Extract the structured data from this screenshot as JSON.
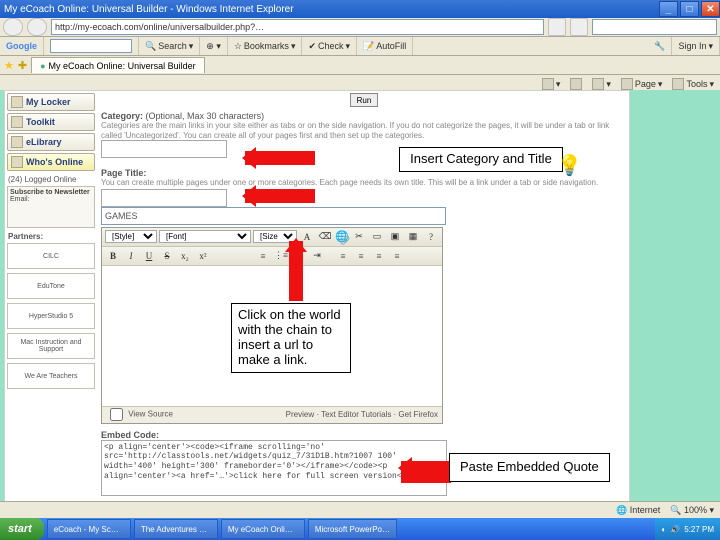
{
  "window": {
    "title": "My eCoach Online: Universal Builder - Windows Internet Explorer"
  },
  "address": "http://my-ecoach.com/online/universalbuilder.php?…",
  "google_bar": {
    "brand": "Google",
    "search_btn": "Search",
    "bookmarks": "Bookmarks",
    "check": "Check",
    "autofill": "AutoFill",
    "signin": "Sign In"
  },
  "tab": {
    "label": "My eCoach Online: Universal Builder"
  },
  "cmdbar": {
    "home": "",
    "print": "",
    "page": "Page",
    "tools": "Tools"
  },
  "sidebar": {
    "buttons": [
      {
        "label": "My Locker"
      },
      {
        "label": "Toolkit"
      },
      {
        "label": "eLibrary"
      },
      {
        "label": "Who's Online"
      },
      {
        "label": "(24) Logged Online"
      }
    ],
    "newsletter_title": "Subscribe to Newsletter",
    "newsletter_sub": "Email:",
    "partners_label": "Partners:",
    "partners": [
      "CILC",
      "EduTone",
      "HyperStudio 5",
      "Mac Instruction and Support",
      "We Are Teachers"
    ]
  },
  "form": {
    "category_label": "Category:",
    "category_hint": "(Optional, Max 30 characters)",
    "category_desc": "Categories are the main links in your site either as tabs or on the side navigation. If you do not categorize the pages, it will be under a tab or link called 'Uncategorized'. You can create all of your pages first and then set up the categories.",
    "btn_run": "Run",
    "pagetitle_label": "Page Title:",
    "pagetitle_desc": "You can create multiple pages under one or more categories. Each page needs its own title. This will be a link under a tab or side navigation.",
    "pagetitle_value": "GAMES",
    "style_sel": "[Style]",
    "font_sel": "[Font]",
    "size_sel": "[Size]",
    "viewsource": "View Source",
    "preview": "Preview",
    "tutorials": "Text Editor Tutorials",
    "get": "Get Firefox",
    "embed_label": "Embed Code:",
    "embed_code": "<p align='center'><code><iframe scrolling='no' src='http://classtools.net/widgets/quiz_7/31D1B.htm?1007 100' width='400' height='300' frameborder='0'></iframe></code><p align='center'><a href='…'>click here for full screen version</a></p>"
  },
  "annotations": {
    "insert": "Insert Category and Title",
    "link": "Click on the world with the chain to insert a url to make a link.",
    "embed": "Paste Embedded Quote"
  },
  "iestatus": {
    "zone": "Internet",
    "zoom": "100%"
  },
  "taskbar": {
    "start": "start",
    "tasks": [
      "eCoach - My Sc…",
      "The Adventures …",
      "My eCoach Onli…",
      "Microsoft PowerPo…"
    ],
    "time": "5:27 PM"
  }
}
